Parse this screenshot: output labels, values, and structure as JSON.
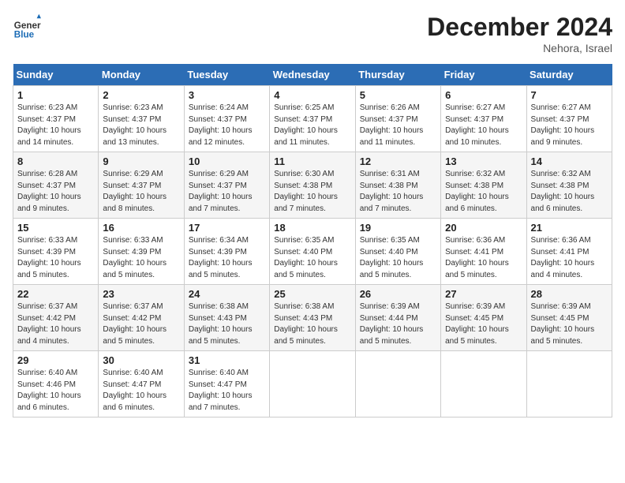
{
  "logo": {
    "general": "General",
    "blue": "Blue"
  },
  "header": {
    "month_year": "December 2024",
    "location": "Nehora, Israel"
  },
  "weekdays": [
    "Sunday",
    "Monday",
    "Tuesday",
    "Wednesday",
    "Thursday",
    "Friday",
    "Saturday"
  ],
  "weeks": [
    [
      {
        "day": "1",
        "sunrise": "6:23 AM",
        "sunset": "4:37 PM",
        "daylight": "10 hours and 14 minutes."
      },
      {
        "day": "2",
        "sunrise": "6:23 AM",
        "sunset": "4:37 PM",
        "daylight": "10 hours and 13 minutes."
      },
      {
        "day": "3",
        "sunrise": "6:24 AM",
        "sunset": "4:37 PM",
        "daylight": "10 hours and 12 minutes."
      },
      {
        "day": "4",
        "sunrise": "6:25 AM",
        "sunset": "4:37 PM",
        "daylight": "10 hours and 11 minutes."
      },
      {
        "day": "5",
        "sunrise": "6:26 AM",
        "sunset": "4:37 PM",
        "daylight": "10 hours and 11 minutes."
      },
      {
        "day": "6",
        "sunrise": "6:27 AM",
        "sunset": "4:37 PM",
        "daylight": "10 hours and 10 minutes."
      },
      {
        "day": "7",
        "sunrise": "6:27 AM",
        "sunset": "4:37 PM",
        "daylight": "10 hours and 9 minutes."
      }
    ],
    [
      {
        "day": "8",
        "sunrise": "6:28 AM",
        "sunset": "4:37 PM",
        "daylight": "10 hours and 9 minutes."
      },
      {
        "day": "9",
        "sunrise": "6:29 AM",
        "sunset": "4:37 PM",
        "daylight": "10 hours and 8 minutes."
      },
      {
        "day": "10",
        "sunrise": "6:29 AM",
        "sunset": "4:37 PM",
        "daylight": "10 hours and 7 minutes."
      },
      {
        "day": "11",
        "sunrise": "6:30 AM",
        "sunset": "4:38 PM",
        "daylight": "10 hours and 7 minutes."
      },
      {
        "day": "12",
        "sunrise": "6:31 AM",
        "sunset": "4:38 PM",
        "daylight": "10 hours and 7 minutes."
      },
      {
        "day": "13",
        "sunrise": "6:32 AM",
        "sunset": "4:38 PM",
        "daylight": "10 hours and 6 minutes."
      },
      {
        "day": "14",
        "sunrise": "6:32 AM",
        "sunset": "4:38 PM",
        "daylight": "10 hours and 6 minutes."
      }
    ],
    [
      {
        "day": "15",
        "sunrise": "6:33 AM",
        "sunset": "4:39 PM",
        "daylight": "10 hours and 5 minutes."
      },
      {
        "day": "16",
        "sunrise": "6:33 AM",
        "sunset": "4:39 PM",
        "daylight": "10 hours and 5 minutes."
      },
      {
        "day": "17",
        "sunrise": "6:34 AM",
        "sunset": "4:39 PM",
        "daylight": "10 hours and 5 minutes."
      },
      {
        "day": "18",
        "sunrise": "6:35 AM",
        "sunset": "4:40 PM",
        "daylight": "10 hours and 5 minutes."
      },
      {
        "day": "19",
        "sunrise": "6:35 AM",
        "sunset": "4:40 PM",
        "daylight": "10 hours and 5 minutes."
      },
      {
        "day": "20",
        "sunrise": "6:36 AM",
        "sunset": "4:41 PM",
        "daylight": "10 hours and 5 minutes."
      },
      {
        "day": "21",
        "sunrise": "6:36 AM",
        "sunset": "4:41 PM",
        "daylight": "10 hours and 4 minutes."
      }
    ],
    [
      {
        "day": "22",
        "sunrise": "6:37 AM",
        "sunset": "4:42 PM",
        "daylight": "10 hours and 4 minutes."
      },
      {
        "day": "23",
        "sunrise": "6:37 AM",
        "sunset": "4:42 PM",
        "daylight": "10 hours and 5 minutes."
      },
      {
        "day": "24",
        "sunrise": "6:38 AM",
        "sunset": "4:43 PM",
        "daylight": "10 hours and 5 minutes."
      },
      {
        "day": "25",
        "sunrise": "6:38 AM",
        "sunset": "4:43 PM",
        "daylight": "10 hours and 5 minutes."
      },
      {
        "day": "26",
        "sunrise": "6:39 AM",
        "sunset": "4:44 PM",
        "daylight": "10 hours and 5 minutes."
      },
      {
        "day": "27",
        "sunrise": "6:39 AM",
        "sunset": "4:45 PM",
        "daylight": "10 hours and 5 minutes."
      },
      {
        "day": "28",
        "sunrise": "6:39 AM",
        "sunset": "4:45 PM",
        "daylight": "10 hours and 5 minutes."
      }
    ],
    [
      {
        "day": "29",
        "sunrise": "6:40 AM",
        "sunset": "4:46 PM",
        "daylight": "10 hours and 6 minutes."
      },
      {
        "day": "30",
        "sunrise": "6:40 AM",
        "sunset": "4:47 PM",
        "daylight": "10 hours and 6 minutes."
      },
      {
        "day": "31",
        "sunrise": "6:40 AM",
        "sunset": "4:47 PM",
        "daylight": "10 hours and 7 minutes."
      },
      null,
      null,
      null,
      null
    ]
  ]
}
